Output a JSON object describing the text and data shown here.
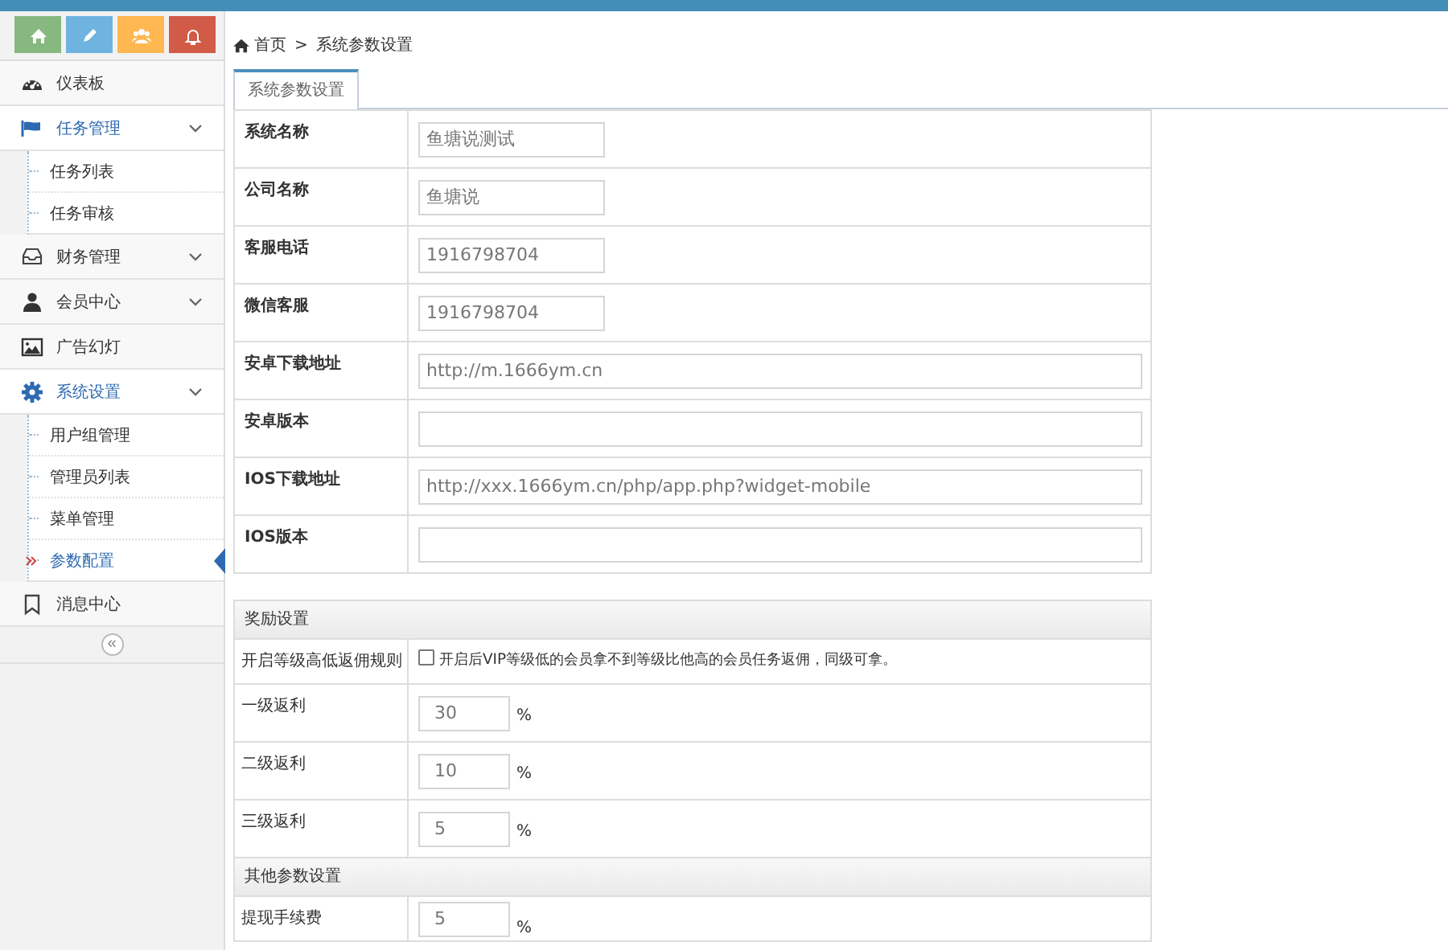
{
  "shortcuts": [
    {
      "color": "#87b87f"
    },
    {
      "color": "#6fb3e0"
    },
    {
      "color": "#ffb752"
    },
    {
      "color": "#d15b47"
    }
  ],
  "menu": [
    {
      "label": "仪表板"
    },
    {
      "label": "任务管理",
      "expanded": true,
      "children": [
        {
          "label": "任务列表",
          "selected": false
        },
        {
          "label": "任务审核",
          "selected": false
        }
      ]
    },
    {
      "label": "财务管理",
      "expanded": false
    },
    {
      "label": "会员中心",
      "expanded": false
    },
    {
      "label": "广告幻灯"
    },
    {
      "label": "系统设置",
      "expanded": true,
      "children": [
        {
          "label": "用户组管理",
          "selected": false
        },
        {
          "label": "管理员列表",
          "selected": false
        },
        {
          "label": "菜单管理",
          "selected": false
        },
        {
          "label": "参数配置",
          "selected": true
        }
      ]
    },
    {
      "label": "消息中心"
    }
  ],
  "collapse_symbol": "«",
  "breadcrumb": {
    "items": [
      "首页",
      "系统参数设置"
    ],
    "separator": ">"
  },
  "tabs": [
    {
      "label": "系统参数设置",
      "selected": true
    }
  ],
  "form": {
    "rows": [
      {
        "kind": "short",
        "label": "系统名称",
        "value": "鱼塘说测试"
      },
      {
        "kind": "short",
        "label": "公司名称",
        "value": "鱼塘说"
      },
      {
        "kind": "short",
        "label": "客服电话",
        "value": "1916798704"
      },
      {
        "kind": "short",
        "label": "微信客服",
        "value": "1916798704"
      },
      {
        "kind": "wide",
        "label": "安卓下载地址",
        "value": "http://m.1666ym.cn"
      },
      {
        "kind": "wide",
        "label": "安卓版本"
      },
      {
        "kind": "wide",
        "label": "IOS下载地址",
        "value": "http://xxx.1666ym.cn/php/app.php?widget-mobile"
      },
      {
        "kind": "wide",
        "label": "IOS版本"
      }
    ]
  },
  "sections": [
    {
      "title": "奖励设置",
      "rows": [
        {
          "kind": "checkbox",
          "label": "开启等级高低返佣规则",
          "checked": false,
          "text": "开启后VIP等级低的会员拿不到等级比他高的会员任务返佣，同级可拿。"
        },
        {
          "kind": "percent",
          "label": "一级返利",
          "value": "30",
          "unit": "%"
        },
        {
          "kind": "percent",
          "label": "二级返利",
          "value": "10",
          "unit": "%"
        },
        {
          "kind": "percent",
          "label": "三级返利",
          "value": "5",
          "unit": "%"
        }
      ]
    },
    {
      "title": "其他参数设置",
      "rows": [
        {
          "kind": "percent",
          "label": "提现手续费",
          "value": "5",
          "unit": "%"
        }
      ]
    }
  ]
}
